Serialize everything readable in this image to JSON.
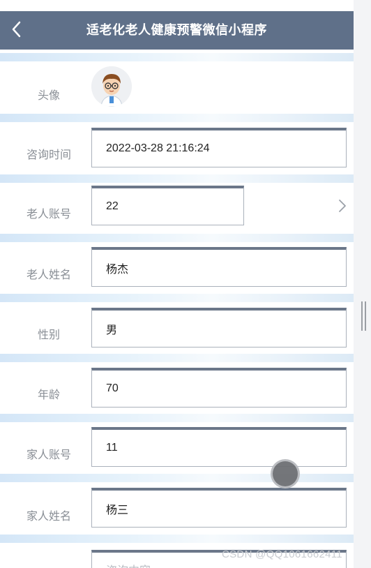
{
  "header": {
    "title": "适老化老人健康预警微信小程序",
    "back_icon": "chevron-left-icon"
  },
  "form": {
    "avatar_label": "头像",
    "fields": [
      {
        "label": "咨询时间",
        "value": "2022-03-28 21:16:24"
      },
      {
        "label": "老人账号",
        "value": "22"
      },
      {
        "label": "老人姓名",
        "value": "杨杰"
      },
      {
        "label": "性别",
        "value": "男"
      },
      {
        "label": "年龄",
        "value": "70"
      },
      {
        "label": "家人账号",
        "value": "11"
      },
      {
        "label": "家人姓名",
        "value": "杨三"
      }
    ],
    "consult_placeholder": "咨询内容"
  },
  "watermark": "CSDN @QQ1061662411",
  "colors": {
    "navbar": "#5f7089",
    "field_border_top": "#6b7789",
    "label_text": "#8a8f96"
  }
}
